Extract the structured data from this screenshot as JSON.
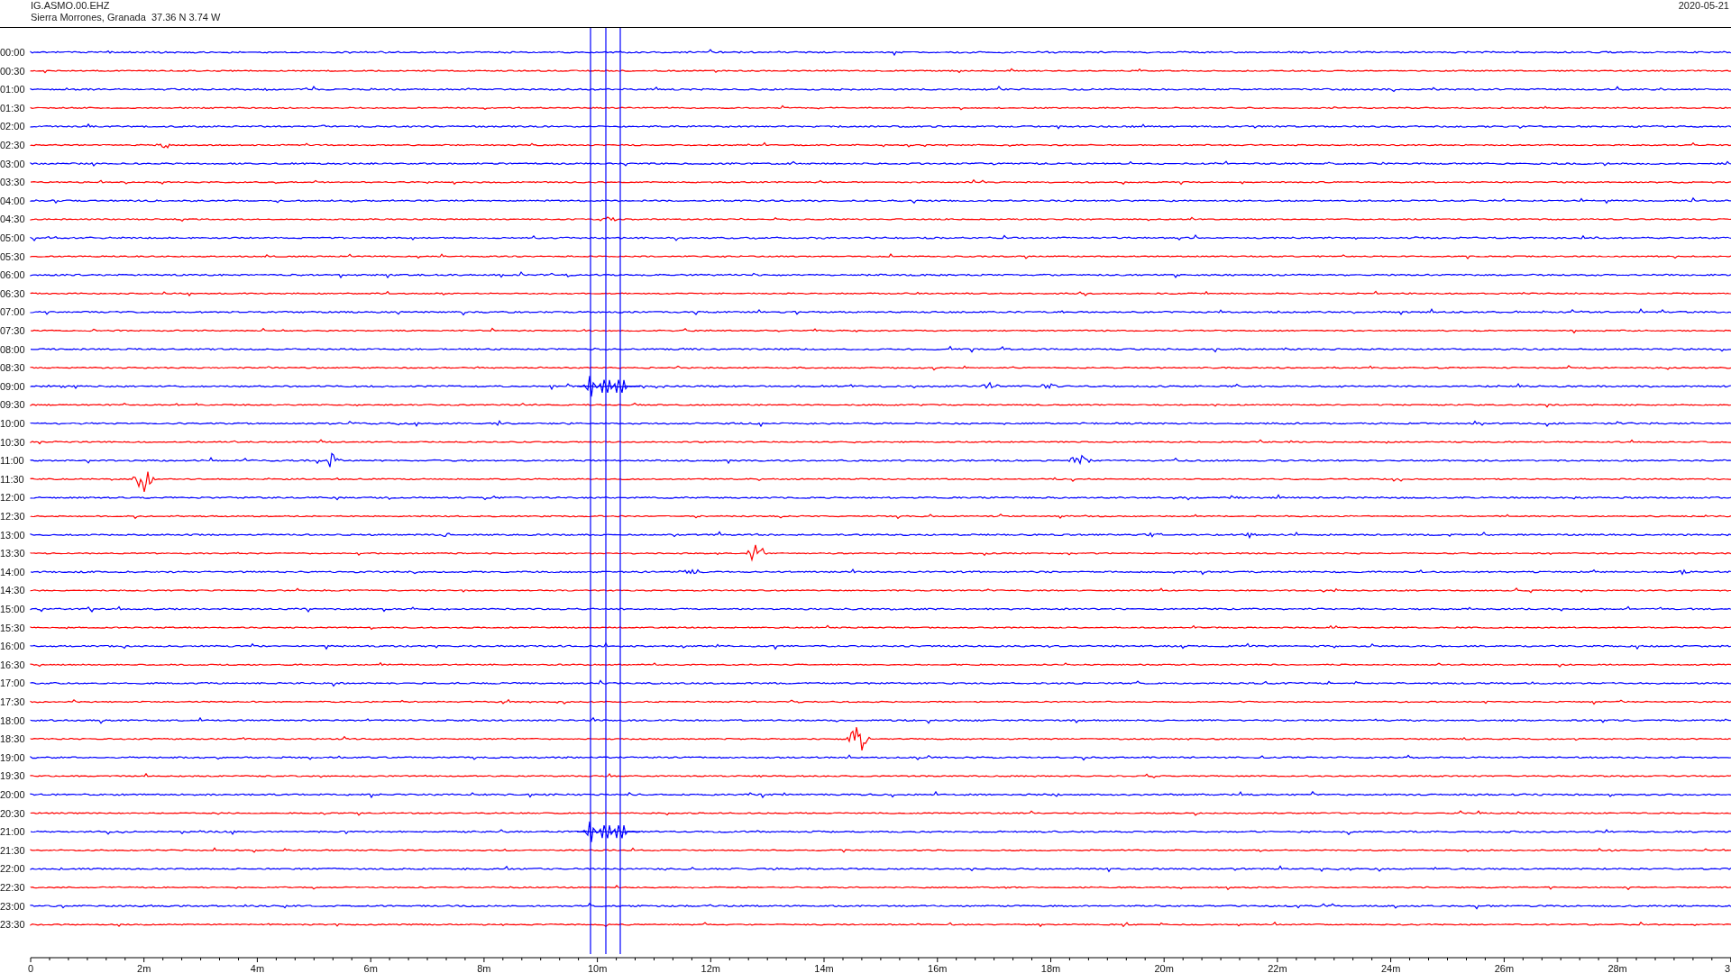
{
  "header": {
    "station": "IG.ASMO.00.EHZ",
    "location": "Sierra Morrones, Granada  37.36 N 3.74 W",
    "date": "2020-05-21"
  },
  "rows": [
    {
      "label": "00:00",
      "color": "#0000ff"
    },
    {
      "label": "00:30",
      "color": "#ff0000"
    },
    {
      "label": "01:00",
      "color": "#0000ff"
    },
    {
      "label": "01:30",
      "color": "#ff0000"
    },
    {
      "label": "02:00",
      "color": "#0000ff"
    },
    {
      "label": "02:30",
      "color": "#ff0000"
    },
    {
      "label": "03:00",
      "color": "#0000ff"
    },
    {
      "label": "03:30",
      "color": "#ff0000"
    },
    {
      "label": "04:00",
      "color": "#0000ff"
    },
    {
      "label": "04:30",
      "color": "#ff0000"
    },
    {
      "label": "05:00",
      "color": "#0000ff"
    },
    {
      "label": "05:30",
      "color": "#ff0000"
    },
    {
      "label": "06:00",
      "color": "#0000ff"
    },
    {
      "label": "06:30",
      "color": "#ff0000"
    },
    {
      "label": "07:00",
      "color": "#0000ff"
    },
    {
      "label": "07:30",
      "color": "#ff0000"
    },
    {
      "label": "08:00",
      "color": "#0000ff"
    },
    {
      "label": "08:30",
      "color": "#ff0000"
    },
    {
      "label": "09:00",
      "color": "#0000ff"
    },
    {
      "label": "09:30",
      "color": "#ff0000"
    },
    {
      "label": "10:00",
      "color": "#0000ff"
    },
    {
      "label": "10:30",
      "color": "#ff0000"
    },
    {
      "label": "11:00",
      "color": "#0000ff"
    },
    {
      "label": "11:30",
      "color": "#ff0000"
    },
    {
      "label": "12:00",
      "color": "#0000ff"
    },
    {
      "label": "12:30",
      "color": "#ff0000"
    },
    {
      "label": "13:00",
      "color": "#0000ff"
    },
    {
      "label": "13:30",
      "color": "#ff0000"
    },
    {
      "label": "14:00",
      "color": "#0000ff"
    },
    {
      "label": "14:30",
      "color": "#ff0000"
    },
    {
      "label": "15:00",
      "color": "#0000ff"
    },
    {
      "label": "15:30",
      "color": "#ff0000"
    },
    {
      "label": "16:00",
      "color": "#0000ff"
    },
    {
      "label": "16:30",
      "color": "#ff0000"
    },
    {
      "label": "17:00",
      "color": "#0000ff"
    },
    {
      "label": "17:30",
      "color": "#ff0000"
    },
    {
      "label": "18:00",
      "color": "#0000ff"
    },
    {
      "label": "18:30",
      "color": "#ff0000"
    },
    {
      "label": "19:00",
      "color": "#0000ff"
    },
    {
      "label": "19:30",
      "color": "#ff0000"
    },
    {
      "label": "20:00",
      "color": "#0000ff"
    },
    {
      "label": "20:30",
      "color": "#ff0000"
    },
    {
      "label": "21:00",
      "color": "#0000ff"
    },
    {
      "label": "21:30",
      "color": "#ff0000"
    },
    {
      "label": "22:00",
      "color": "#0000ff"
    },
    {
      "label": "22:30",
      "color": "#ff0000"
    },
    {
      "label": "23:00",
      "color": "#0000ff"
    },
    {
      "label": "23:30",
      "color": "#ff0000"
    }
  ],
  "x_axis": {
    "ticks": [
      "0",
      "2m",
      "4m",
      "6m",
      "8m",
      "10m",
      "12m",
      "14m",
      "16m",
      "18m",
      "20m",
      "22m",
      "24m",
      "26m",
      "28m",
      "3"
    ]
  }
}
